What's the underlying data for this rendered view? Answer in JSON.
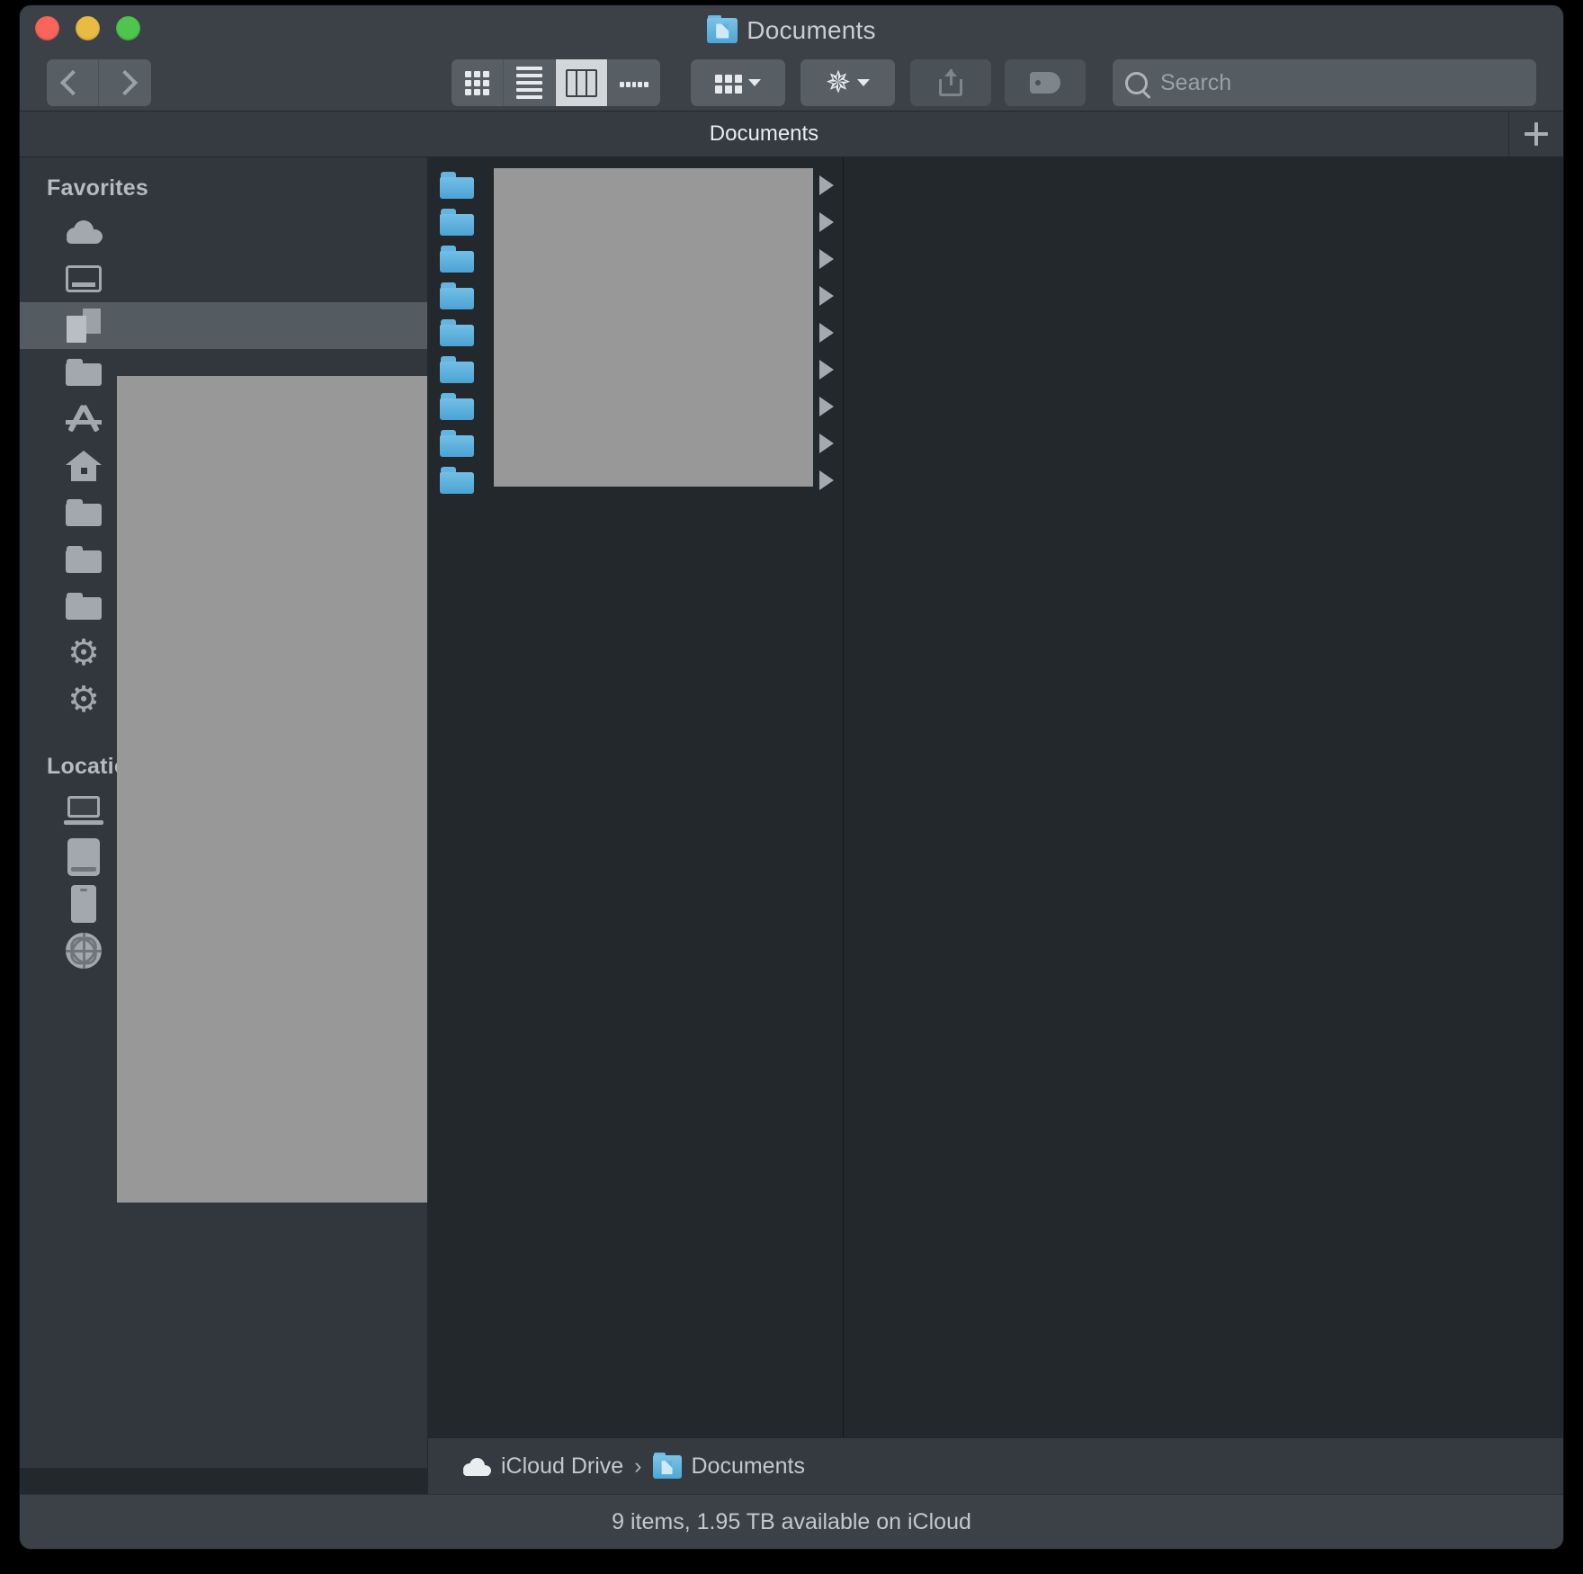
{
  "window": {
    "title": "Documents",
    "title_icon": "documents-folder-icon",
    "traffic_lights": [
      {
        "name": "close",
        "color": "#f9655b"
      },
      {
        "name": "minimize",
        "color": "#e9bb43"
      },
      {
        "name": "maximize",
        "color": "#4fc44f"
      }
    ]
  },
  "toolbar": {
    "back_icon": "chevron-left-icon",
    "forward_icon": "chevron-right-icon",
    "view_modes": [
      {
        "name": "icon-view",
        "icon": "grid-icon",
        "active": false
      },
      {
        "name": "list-view",
        "icon": "list-icon",
        "active": false
      },
      {
        "name": "column-view",
        "icon": "columns-icon",
        "active": true
      },
      {
        "name": "gallery-view",
        "icon": "gallery-icon",
        "active": false
      }
    ],
    "group_button": {
      "name": "group-items",
      "icon": "group-icon"
    },
    "action_button": {
      "name": "action-menu",
      "icon": "gear-icon"
    },
    "share_button": {
      "name": "share",
      "icon": "share-icon"
    },
    "tag_button": {
      "name": "add-tags",
      "icon": "tag-icon"
    }
  },
  "search": {
    "placeholder": "Search",
    "value": "",
    "icon": "search-icon"
  },
  "tabbar": {
    "active_tab": "Documents",
    "new_tab_icon": "plus-icon"
  },
  "sidebar": {
    "sections": [
      {
        "header": "Favorites",
        "items": [
          {
            "icon": "icloud-icon",
            "label": "",
            "selected": false
          },
          {
            "icon": "desktop-icon",
            "label": "",
            "selected": false
          },
          {
            "icon": "documents-icon",
            "label": "",
            "selected": true
          },
          {
            "icon": "folder-icon",
            "label": "",
            "selected": false
          },
          {
            "icon": "applications-icon",
            "label": "",
            "selected": false
          },
          {
            "icon": "home-icon",
            "label": "",
            "selected": false
          },
          {
            "icon": "folder-icon",
            "label": "",
            "selected": false
          },
          {
            "icon": "folder-icon",
            "label": "",
            "selected": false
          },
          {
            "icon": "folder-icon",
            "label": "",
            "selected": false
          },
          {
            "icon": "gear-icon",
            "label": "",
            "selected": false
          },
          {
            "icon": "gear-icon",
            "label": "",
            "selected": false
          }
        ]
      },
      {
        "header": "Locations",
        "items": [
          {
            "icon": "laptop-icon",
            "label": "",
            "selected": false
          },
          {
            "icon": "drive-icon",
            "label": "",
            "selected": false
          },
          {
            "icon": "iphone-icon",
            "label": "",
            "selected": false
          },
          {
            "icon": "network-icon",
            "label": "",
            "selected": false
          }
        ]
      }
    ]
  },
  "columns": {
    "column1": {
      "items": [
        {
          "icon": "blue-folder-icon",
          "label": "",
          "has_disclosure": true
        },
        {
          "icon": "blue-folder-icon",
          "label": "",
          "has_disclosure": true
        },
        {
          "icon": "blue-folder-icon",
          "label": "",
          "has_disclosure": true
        },
        {
          "icon": "blue-folder-icon",
          "label": "",
          "has_disclosure": true
        },
        {
          "icon": "blue-folder-icon",
          "label": "",
          "has_disclosure": true
        },
        {
          "icon": "blue-folder-icon",
          "label": "",
          "has_disclosure": true
        },
        {
          "icon": "blue-folder-icon",
          "label": "",
          "has_disclosure": true
        },
        {
          "icon": "blue-folder-icon",
          "label": "",
          "has_disclosure": true
        },
        {
          "icon": "blue-folder-icon",
          "label": "",
          "has_disclosure": true
        }
      ]
    }
  },
  "pathbar": {
    "crumbs": [
      {
        "label": "iCloud Drive",
        "icon": "cloud-icon"
      },
      {
        "label": "Documents",
        "icon": "documents-folder-icon"
      }
    ],
    "separator": "›"
  },
  "statusbar": {
    "text": "9 items, 1.95 TB available on iCloud"
  },
  "colors": {
    "window_chrome": "#3b4146",
    "sidebar_bg": "#31373c",
    "content_bg": "#22282c",
    "accent_folder": "#4ba3d4",
    "selection": "#545b61",
    "redaction": "#989898"
  }
}
